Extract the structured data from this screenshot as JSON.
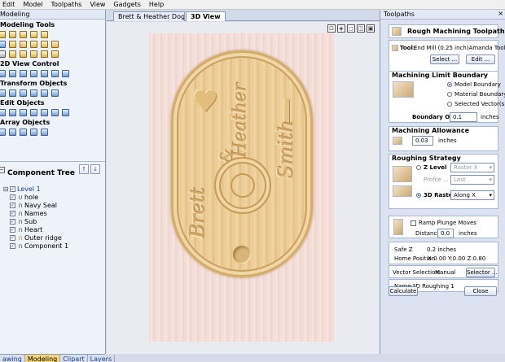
{
  "menu": [
    "Edit",
    "Model",
    "Toolpaths",
    "View",
    "Gadgets",
    "Help"
  ],
  "left_panel": {
    "title": "Modeling",
    "sections": [
      "Modeling Tools",
      "2D View Control",
      "Transform Objects",
      "Edit Objects",
      "Array Objects"
    ]
  },
  "component_tree": {
    "title": "Component Tree",
    "items": [
      {
        "label": "Level 1",
        "checked": true
      },
      {
        "label": "hole",
        "checked": true
      },
      {
        "label": "Navy Seal",
        "checked": true
      },
      {
        "label": "Names",
        "checked": true
      },
      {
        "label": "Sub",
        "checked": true
      },
      {
        "label": "Heart",
        "checked": true
      },
      {
        "label": "Outer ridge",
        "checked": true
      },
      {
        "label": "Component 1",
        "checked": true
      }
    ]
  },
  "bottom_tabs": [
    "awing",
    "Modeling",
    "Clipart",
    "Layers"
  ],
  "doc_tabs": [
    "Brett & Heather Dog Tag",
    "3D View"
  ],
  "view": {
    "engravings": [
      "Heather",
      "&",
      "Smith",
      "Brett"
    ]
  },
  "toolpaths_panel": {
    "title": "Toolpaths",
    "close": "×",
    "header": "Rough Machining Toolpath",
    "tool_label": "Tool:",
    "tool_value": "End Mill (0.25 inch)Amanda Tool",
    "select_btn": "Select ...",
    "edit_btn": "Edit ...",
    "mlb": {
      "title": "Machining Limit Boundary",
      "options": [
        "Model Boundary",
        "Material Boundary",
        "Selected Vector(s)"
      ],
      "offset_label": "Boundary Offset",
      "offset_value": "0.1",
      "offset_unit": "inches"
    },
    "allowance": {
      "title": "Machining Allowance",
      "value": "0.03",
      "unit": "inches"
    },
    "roughing": {
      "title": "Roughing Strategy",
      "z_level": "Z Level",
      "z_dd": "Raster X",
      "profile": "Profile ...",
      "profile_dd": "Last",
      "raster": "3D Raster",
      "raster_dd": "Along X"
    },
    "ramp": {
      "label": "Ramp Plunge Moves",
      "dist_label": "Distance",
      "dist_value": "0.0",
      "unit": "inches"
    },
    "safe_z_label": "Safe Z",
    "safe_z_value": "0.2 inches",
    "home_label": "Home Position",
    "home_value": "X:0.00 Y:0.00 Z:0.80",
    "vector_label": "Vector Selection:",
    "vector_value": "Manual",
    "selector_btn": "Selector ...",
    "name_label": "Name:",
    "name_value": "3D Roughing 1",
    "calculate_btn": "Calculate",
    "close_btn": "Close"
  }
}
